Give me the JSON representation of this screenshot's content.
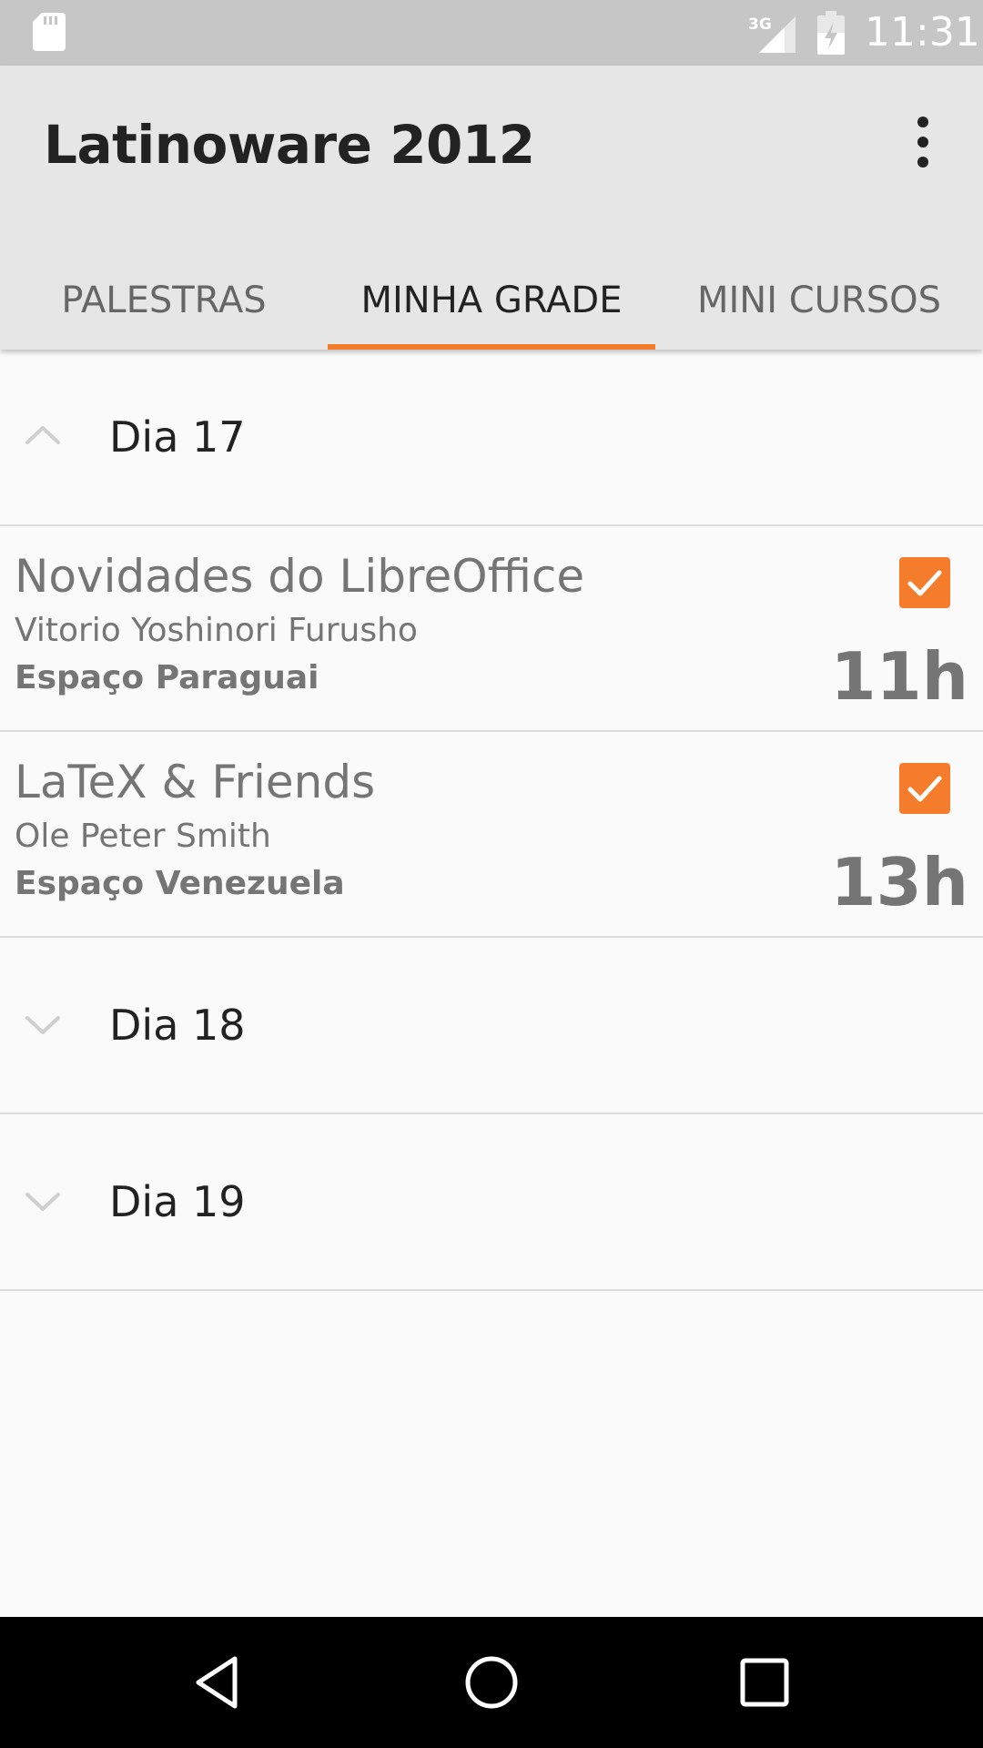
{
  "status_bar": {
    "time": "11:31",
    "network": "3G",
    "icons": [
      "sd-card-icon",
      "signal-icon",
      "battery-icon"
    ]
  },
  "app_bar": {
    "title": "Latinoware 2012",
    "menu_icon": "more-vert-icon"
  },
  "tabs": [
    {
      "label": "PALESTRAS",
      "active": false
    },
    {
      "label": "MINHA GRADE",
      "active": true
    },
    {
      "label": "MINI CURSOS",
      "active": false
    }
  ],
  "groups": [
    {
      "label": "Dia 17",
      "expanded": true,
      "talks": [
        {
          "title": "Novidades do LibreOffice",
          "speaker": "Vitorio Yoshinori Furusho",
          "room": "Espaço Paraguai",
          "time": "11h",
          "checked": true
        },
        {
          "title": "LaTeX & Friends",
          "speaker": "Ole Peter Smith",
          "room": "Espaço Venezuela",
          "time": "13h",
          "checked": true
        }
      ]
    },
    {
      "label": "Dia 18",
      "expanded": false,
      "talks": []
    },
    {
      "label": "Dia 19",
      "expanded": false,
      "talks": []
    }
  ],
  "colors": {
    "accent": "#f57c2b",
    "app_bar": "#e6e6e6",
    "status_bar": "#c6c6c6",
    "background": "#fafafa"
  },
  "nav_bar": {
    "icons": [
      "back-icon",
      "home-icon",
      "recents-icon"
    ]
  }
}
